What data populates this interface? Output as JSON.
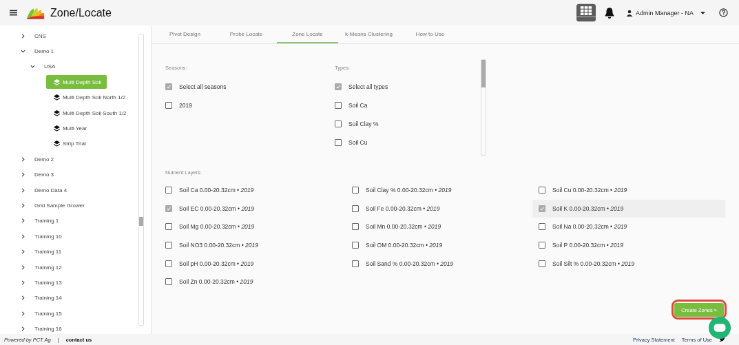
{
  "app": {
    "title": "Zone/Locate",
    "user": "Admin Manager - NA"
  },
  "sidebar": {
    "tree": [
      {
        "label": "CNS",
        "expanded": false
      },
      {
        "label": "Demo 1",
        "expanded": true,
        "children": [
          {
            "label": "USA",
            "expanded": true,
            "children": [
              {
                "label": "Multi Depth Soil",
                "selected": true
              },
              {
                "label": "Multi Depth Soil North 1/2",
                "selected": false
              },
              {
                "label": "Multi Depth Soil South 1/2",
                "selected": false
              },
              {
                "label": "Multi Year",
                "selected": false
              },
              {
                "label": "Strip Trial",
                "selected": false
              }
            ]
          }
        ]
      },
      {
        "label": "Demo 2",
        "expanded": false
      },
      {
        "label": "Demo 3",
        "expanded": false
      },
      {
        "label": "Demo Data 4",
        "expanded": false
      },
      {
        "label": "Grid Sample Grower",
        "expanded": false
      },
      {
        "label": "Training 1",
        "expanded": false
      },
      {
        "label": "Training 10",
        "expanded": false
      },
      {
        "label": "Training 11",
        "expanded": false
      },
      {
        "label": "Training 12",
        "expanded": false
      },
      {
        "label": "Training 13",
        "expanded": false
      },
      {
        "label": "Training 14",
        "expanded": false
      },
      {
        "label": "Training 15",
        "expanded": false
      },
      {
        "label": "Training 16",
        "expanded": false
      }
    ]
  },
  "tabs": [
    {
      "label": "Pivot Design",
      "selected": false
    },
    {
      "label": "Probe Locate",
      "selected": false
    },
    {
      "label": "Zone Locate",
      "selected": true
    },
    {
      "label": "k-Means Clustering",
      "selected": false
    },
    {
      "label": "How to Use",
      "selected": false
    }
  ],
  "seasons": {
    "label": "Seasons:",
    "options": [
      {
        "label": "Select all seasons",
        "checked": true,
        "disabled": true
      },
      {
        "label": "2019",
        "checked": false,
        "disabled": false
      }
    ]
  },
  "types": {
    "label": "Types:",
    "options": [
      {
        "label": "Select all types",
        "checked": true,
        "disabled": true
      },
      {
        "label": "Soil Ca",
        "checked": false,
        "disabled": false
      },
      {
        "label": "Soil Clay %",
        "checked": false,
        "disabled": false
      },
      {
        "label": "Soil Cu",
        "checked": false,
        "disabled": false
      }
    ]
  },
  "nutrient_layers": {
    "label": "Nutrient Layers:",
    "options": [
      {
        "label": "Soil Ca 0.00-20.32cm • *2019*",
        "checked": false,
        "highlighted": false
      },
      {
        "label": "Soil Clay % 0.00-20.32cm • *2019*",
        "checked": false,
        "highlighted": false
      },
      {
        "label": "Soil Cu 0.00-20.32cm • *2019*",
        "checked": false,
        "highlighted": false
      },
      {
        "label": "Soil EC 0.00-20.32cm • *2019*",
        "checked": true,
        "highlighted": false
      },
      {
        "label": "Soil Fe 0.00-20.32cm • *2019*",
        "checked": false,
        "highlighted": false
      },
      {
        "label": "Soil K 0.00-20.32cm • *2019*",
        "checked": true,
        "highlighted": true
      },
      {
        "label": "Soil Mg 0.00-20.32cm • *2019*",
        "checked": false,
        "highlighted": false
      },
      {
        "label": "Soil Mn 0.00-20.32cm • *2019*",
        "checked": false,
        "highlighted": false
      },
      {
        "label": "Soil Na 0.00-20.32cm • *2019*",
        "checked": false,
        "highlighted": false
      },
      {
        "label": "Soil NO3 0.00-20.32cm • *2019*",
        "checked": false,
        "highlighted": false
      },
      {
        "label": "Soil OM 0.00-20.32cm • *2019*",
        "checked": false,
        "highlighted": false
      },
      {
        "label": "Soil P 0.00-20.32cm • *2019*",
        "checked": false,
        "highlighted": false
      },
      {
        "label": "Soil pH 0.00-20.32cm • *2019*",
        "checked": false,
        "highlighted": false
      },
      {
        "label": "Soil Sand % 0.00-20.32cm • *2019*",
        "checked": false,
        "highlighted": false
      },
      {
        "label": "Soil Silt % 0.00-20.32cm • *2019*",
        "checked": false,
        "highlighted": false
      },
      {
        "label": "Soil Zn 0.00-20.32cm • *2019*",
        "checked": false,
        "highlighted": false
      }
    ]
  },
  "create_button": "Create Zones »",
  "footer": {
    "powered_by": "Powered by PCT Ag",
    "separator": "|",
    "contact": "contact us",
    "links": [
      "Privacy Statement",
      "Terms of Use"
    ]
  }
}
